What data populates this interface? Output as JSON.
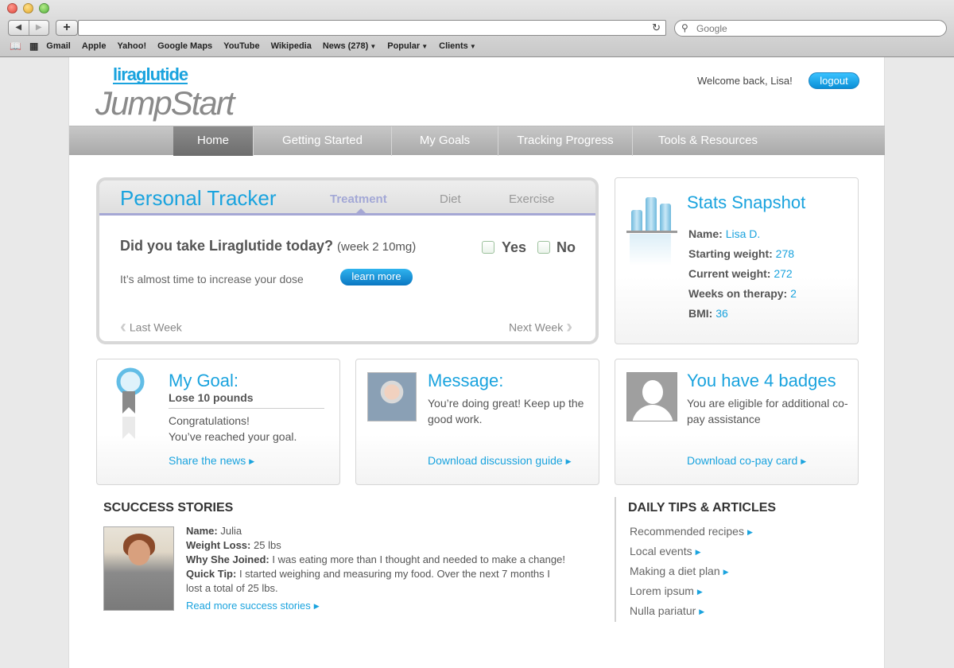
{
  "browser": {
    "search_placeholder": "Google",
    "bookmarks": [
      "Gmail",
      "Apple",
      "Yahoo!",
      "Google Maps",
      "YouTube",
      "Wikipedia",
      "News (278)",
      "Popular",
      "Clients"
    ]
  },
  "header": {
    "logo_top": "liraglutide",
    "logo_main": "JumpStart",
    "welcome": "Welcome back, Lisa!",
    "logout": "logout"
  },
  "nav": [
    "Home",
    "Getting Started",
    "My Goals",
    "Tracking Progress",
    "Tools & Resources"
  ],
  "tracker": {
    "title": "Personal Tracker",
    "tabs": [
      "Treatment",
      "Diet",
      "Exercise"
    ],
    "question": "Did you take Liraglutide today?",
    "question_sub": "(week 2 10mg)",
    "yes": "Yes",
    "no": "No",
    "dose_text": "It’s almost time to increase your dose",
    "learn_more": "learn more",
    "last_week": "Last Week",
    "next_week": "Next Week"
  },
  "stats": {
    "title": "Stats Snapshot",
    "rows": [
      {
        "label": "Name:",
        "value": "Lisa D."
      },
      {
        "label": "Starting weight:",
        "value": "278"
      },
      {
        "label": "Current weight:",
        "value": "272"
      },
      {
        "label": "Weeks on therapy:",
        "value": "2"
      },
      {
        "label": "BMI:",
        "value": "36"
      }
    ]
  },
  "goal": {
    "title": "My Goal:",
    "subtitle": "Lose 10 pounds",
    "line1": "Congratulations!",
    "line2": "You’ve reached your goal.",
    "link": "Share the news"
  },
  "message": {
    "title": "Message:",
    "text": "You’re doing great! Keep up the good work.",
    "link": "Download discussion guide"
  },
  "badges": {
    "title": "You have 4 badges",
    "text": "You are eligible for additional co-pay assistance",
    "link": "Download co-pay card"
  },
  "success": {
    "title": "SCUCCESS STORIES",
    "name_label": "Name:",
    "name": "Julia",
    "loss_label": "Weight Loss:",
    "loss": "25 lbs",
    "why_label": "Why She Joined:",
    "why": "I was eating more than I thought and needed to make a change!",
    "tip_label": "Quick Tip:",
    "tip_line1": "I started weighing and measuring my food. Over the next 7 months I",
    "tip_line2": "lost a total of 25 lbs.",
    "link": "Read more success stories"
  },
  "tips": {
    "title": "DAILY TIPS & ARTICLES",
    "items": [
      "Recommended recipes",
      "Local events",
      "Making a diet plan",
      "Lorem ipsum",
      "Nulla pariatur"
    ]
  }
}
